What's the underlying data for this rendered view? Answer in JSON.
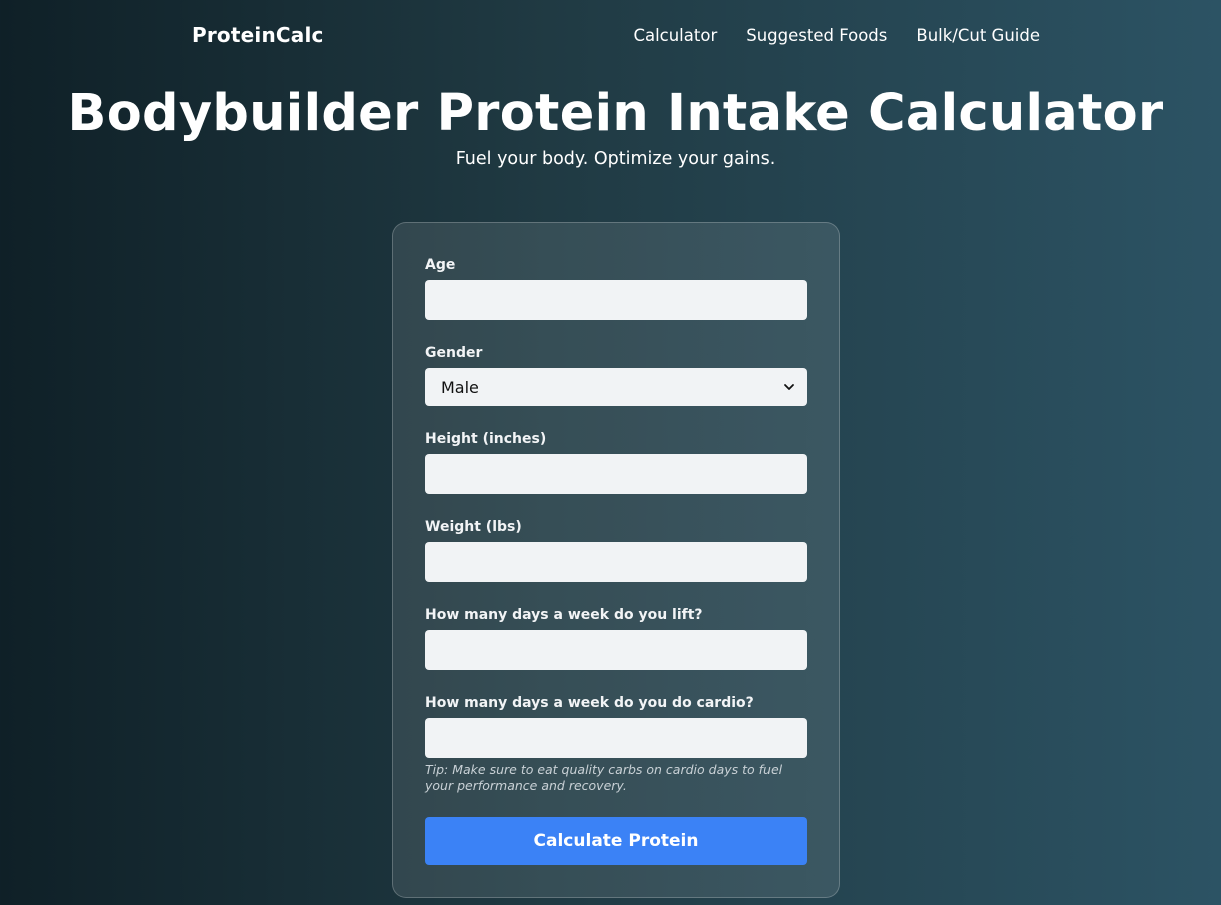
{
  "nav": {
    "brand": "ProteinCalc",
    "links": [
      "Calculator",
      "Suggested Foods",
      "Bulk/Cut Guide"
    ]
  },
  "hero": {
    "title": "Bodybuilder Protein Intake Calculator",
    "subtitle": "Fuel your body. Optimize your gains."
  },
  "form": {
    "age_label": "Age",
    "age_value": "",
    "gender_label": "Gender",
    "gender_value": "Male",
    "height_label": "Height (inches)",
    "height_value": "",
    "weight_label": "Weight (lbs)",
    "weight_value": "",
    "lift_label": "How many days a week do you lift?",
    "lift_value": "",
    "cardio_label": "How many days a week do you do cardio?",
    "cardio_value": "",
    "tip": "Tip: Make sure to eat quality carbs on cardio days to fuel your performance and recovery.",
    "submit_label": "Calculate Protein"
  },
  "colors": {
    "accent": "#3b82f6",
    "bg_start": "#0f2027",
    "bg_end": "#2c5364",
    "input_bg": "#f1f3f5"
  },
  "icons": {
    "gender_select": "chevron-down-icon"
  }
}
